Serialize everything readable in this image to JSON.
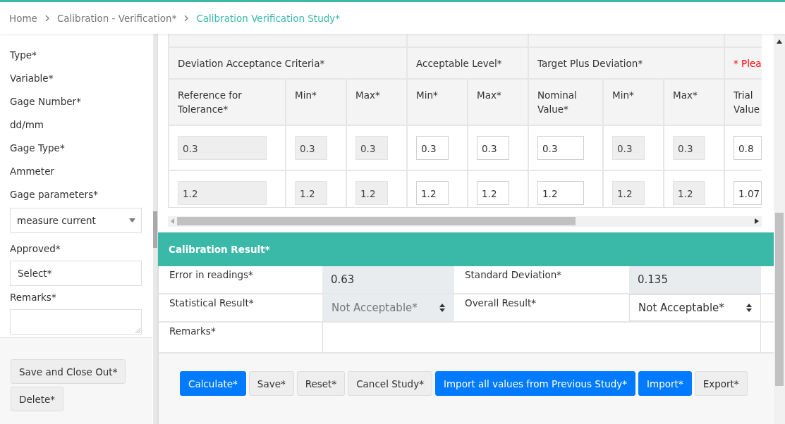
{
  "breadcrumb": [
    {
      "label": "Home",
      "current": false
    },
    {
      "label": "Calibration - Verification*",
      "current": false
    },
    {
      "label": "Calibration Verification Study*",
      "current": true
    }
  ],
  "sidebar": {
    "items": [
      {
        "kind": "label",
        "text": "Type*"
      },
      {
        "kind": "label",
        "text": "Variable*"
      },
      {
        "kind": "label",
        "text": "Gage Number*"
      },
      {
        "kind": "text",
        "text": "dd/mm"
      },
      {
        "kind": "label",
        "text": "Gage Type*"
      },
      {
        "kind": "text",
        "text": "Ammeter"
      },
      {
        "kind": "label",
        "text": "Gage parameters*"
      },
      {
        "kind": "select",
        "value": "measure current"
      },
      {
        "kind": "label",
        "text": "Approved*"
      },
      {
        "kind": "input",
        "value": "Select*"
      },
      {
        "kind": "label",
        "text": "Remarks*"
      },
      {
        "kind": "textarea"
      }
    ],
    "buttons": [
      "Save and Close Out*",
      "Delete*"
    ]
  },
  "table": {
    "groups": [
      {
        "label": "Deviation Acceptance Criteria*",
        "warning": false
      },
      {
        "label": "Acceptable Level*",
        "warning": false
      },
      {
        "label": "Target Plus Deviation*",
        "warning": false
      },
      {
        "label": "* Plea",
        "warning": true
      }
    ],
    "columns": [
      "Reference for Tolerance*",
      "Min*",
      "Max*",
      "Min*",
      "Max*",
      "Nominal Value*",
      "Min*",
      "Max*",
      "Trial Value"
    ],
    "rows": [
      [
        {
          "value": "0.3",
          "readonly": true
        },
        {
          "value": "0.3",
          "readonly": true
        },
        {
          "value": "0.3",
          "readonly": true
        },
        {
          "value": "0.3",
          "readonly": false
        },
        {
          "value": "0.3",
          "readonly": false
        },
        {
          "value": "0.3",
          "readonly": false
        },
        {
          "value": "0.3",
          "readonly": true
        },
        {
          "value": "0.3",
          "readonly": true
        },
        {
          "value": "0.8",
          "readonly": false
        }
      ],
      [
        {
          "value": "1.2",
          "readonly": true
        },
        {
          "value": "1.2",
          "readonly": true
        },
        {
          "value": "1.2",
          "readonly": true
        },
        {
          "value": "1.2",
          "readonly": false
        },
        {
          "value": "1.2",
          "readonly": false
        },
        {
          "value": "1.2",
          "readonly": false
        },
        {
          "value": "1.2",
          "readonly": true
        },
        {
          "value": "1.2",
          "readonly": true
        },
        {
          "value": "1.07",
          "readonly": false
        }
      ]
    ]
  },
  "result": {
    "title": "Calibration Result*",
    "rows": [
      [
        {
          "label": "Error in readings*",
          "kind": "readonly",
          "value": "0.63"
        },
        {
          "label": "Standard Deviation*",
          "kind": "readonly",
          "value": "0.135"
        }
      ],
      [
        {
          "label": "Statistical Result*",
          "kind": "select",
          "value": "Not Acceptable*",
          "disabled": true
        },
        {
          "label": "Overall Result*",
          "kind": "select",
          "value": "Not Acceptable*",
          "disabled": false
        }
      ],
      [
        {
          "label": "Remarks*",
          "kind": "textarea"
        }
      ]
    ]
  },
  "buttons": [
    {
      "label": "Calculate*",
      "kind": "primary"
    },
    {
      "label": "Save*",
      "kind": "secondary"
    },
    {
      "label": "Reset*",
      "kind": "secondary"
    },
    {
      "label": "Cancel Study*",
      "kind": "secondary"
    },
    {
      "label": "Import all values from Previous Study*",
      "kind": "primary"
    },
    {
      "label": "Import*",
      "kind": "primary"
    },
    {
      "label": "Export*",
      "kind": "secondary"
    }
  ]
}
